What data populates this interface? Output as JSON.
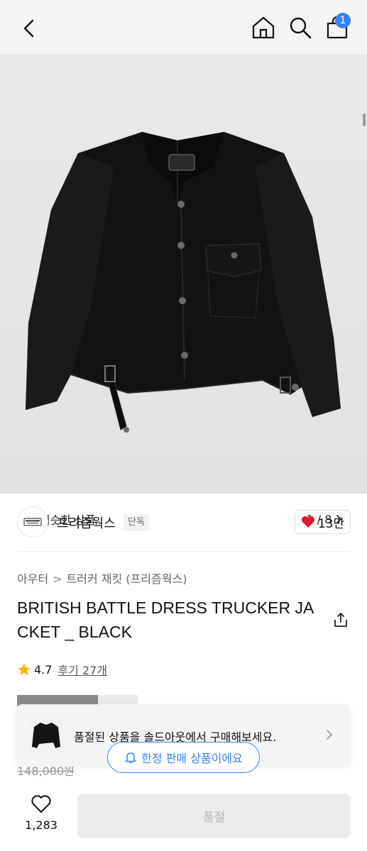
{
  "header": {
    "cart_count": "1",
    "icons": [
      "back-icon",
      "home-icon",
      "search-icon",
      "shopping-bag-icon"
    ]
  },
  "gallery": {
    "similar_label": "비슷한 상품",
    "pager": "1 / 8"
  },
  "brand": {
    "name": "프리즘웍스",
    "exclusive_badge": "단독",
    "likes": "13만"
  },
  "product": {
    "breadcrumb": [
      "아우터",
      "트러커 재킷 (프리즘웍스)"
    ],
    "title": "BRITISH BATTLE DRESS TRUCKER JACKET _ BLACK",
    "rating": "4.7",
    "reviews": "후기 27개",
    "original_price": "148,000원"
  },
  "banner": {
    "text": "품절된 상품을 솔드아웃에서 구매해보세요.",
    "limited_pill": "한정 판매 상품이에요"
  },
  "bottom": {
    "like_count": "1,283",
    "buy_button": "품절"
  },
  "colors": {
    "accent": "#3a82f7",
    "heart": "#e8162e",
    "star": "#f5b400"
  }
}
